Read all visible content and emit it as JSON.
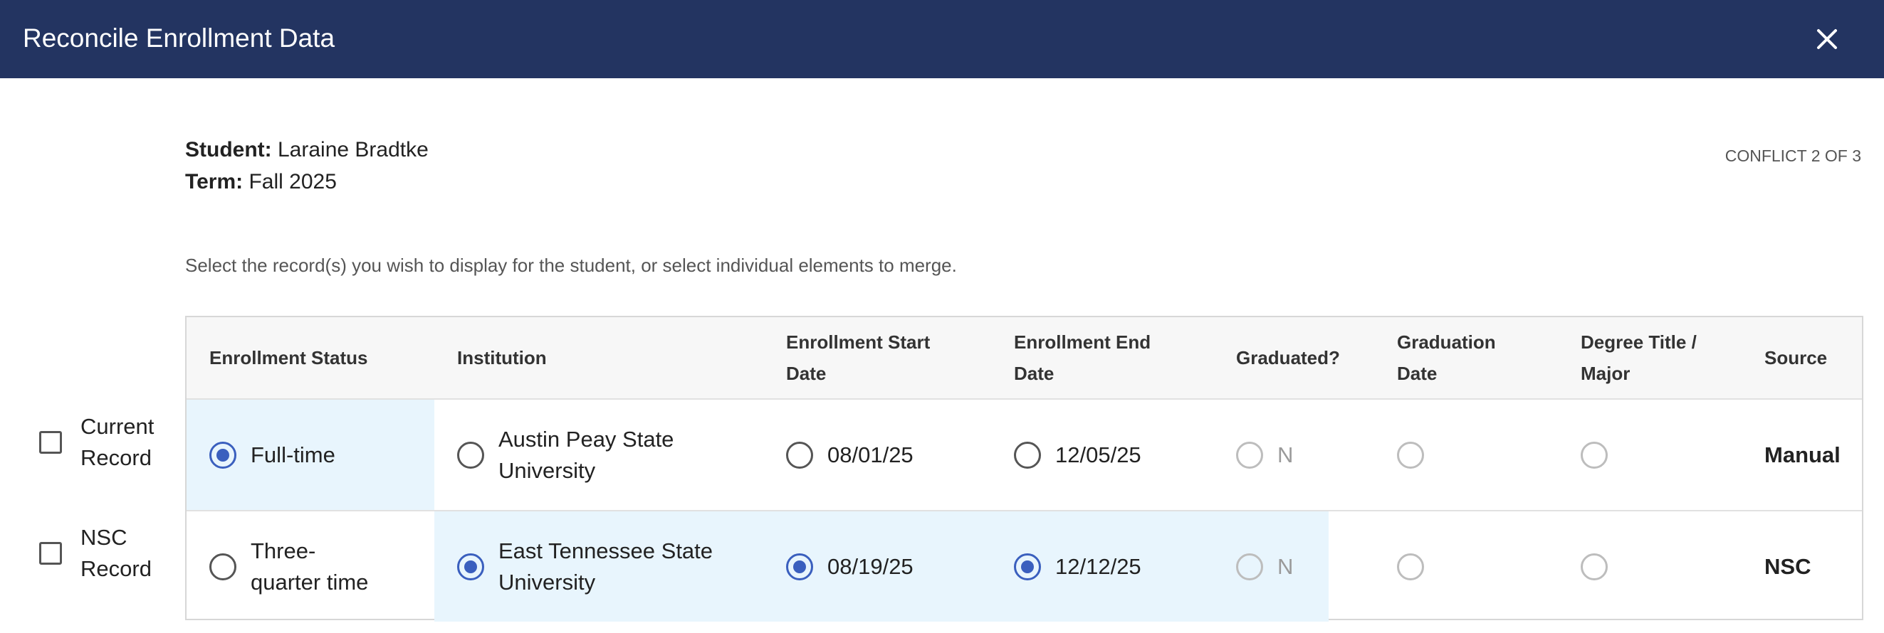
{
  "dialog": {
    "title": "Reconcile Enrollment Data",
    "close_icon": "close-icon"
  },
  "student": {
    "label": "Student:",
    "value": "Laraine Bradtke"
  },
  "term": {
    "label": "Term:",
    "value": "Fall 2025"
  },
  "conflict_counter": "CONFLICT 2 OF 3",
  "instructions": "Select the record(s) you wish to display for the student, or select individual elements to merge.",
  "table": {
    "headers": {
      "status": "Enrollment Status",
      "institution": "Institution",
      "start_line1": "Enrollment Start",
      "start_line2": "Date",
      "end_line1": "Enrollment End",
      "end_line2": "Date",
      "graduated": "Graduated?",
      "grad_line1": "Graduation",
      "grad_line2": "Date",
      "degree_line1": "Degree Title /",
      "degree_line2": "Major",
      "source": "Source"
    },
    "rows": [
      {
        "record_label_line1": "Current",
        "record_label_line2": "Record",
        "status": "Full-time",
        "institution_line1": "Austin Peay State",
        "institution_line2": "University",
        "start": "08/01/25",
        "end": "12/05/25",
        "graduated": "N",
        "source": "Manual"
      },
      {
        "record_label_line1": "NSC",
        "record_label_line2": "Record",
        "status_line1": "Three-",
        "status_line2": "quarter time",
        "institution_line1": "East Tennessee State",
        "institution_line2": "University",
        "start": "08/19/25",
        "end": "12/12/25",
        "graduated": "N",
        "source": "NSC"
      }
    ]
  },
  "colors": {
    "titlebar": "#233461",
    "selected_radio": "#3a5fbe",
    "highlight": "#e8f5fd"
  }
}
